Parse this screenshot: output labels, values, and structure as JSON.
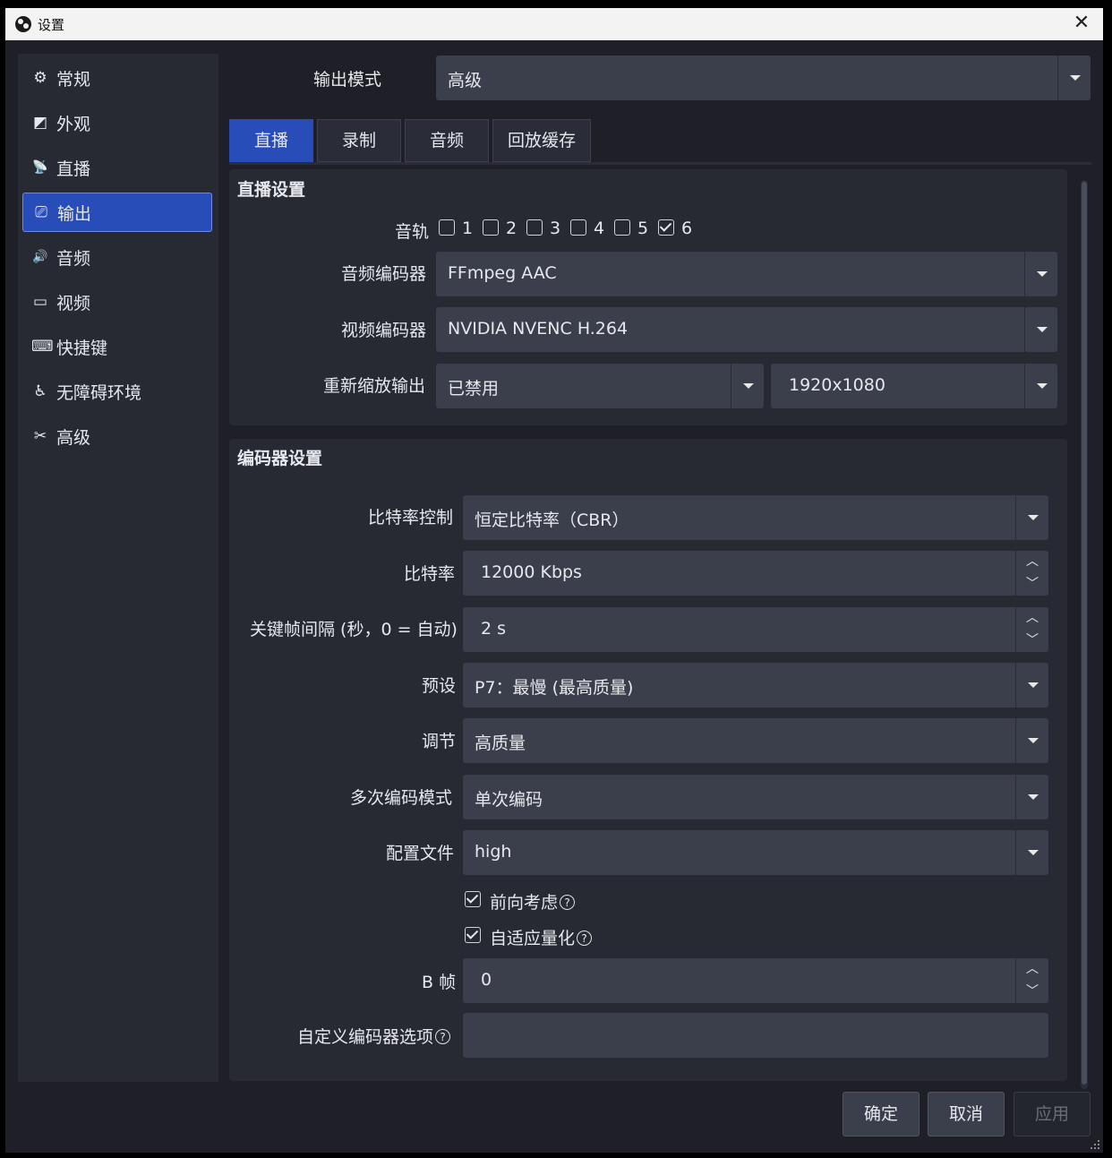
{
  "window": {
    "title": "设置"
  },
  "sidebar": {
    "items": [
      {
        "label": "常规",
        "icon": "gear-icon",
        "glyph": "⚙"
      },
      {
        "label": "外观",
        "icon": "appearance-icon",
        "glyph": "◩"
      },
      {
        "label": "直播",
        "icon": "broadcast-icon",
        "glyph": "📡"
      },
      {
        "label": "输出",
        "icon": "output-icon",
        "glyph": "⎚"
      },
      {
        "label": "音频",
        "icon": "speaker-icon",
        "glyph": "🔊"
      },
      {
        "label": "视频",
        "icon": "monitor-icon",
        "glyph": "▭"
      },
      {
        "label": "快捷键",
        "icon": "keyboard-icon",
        "glyph": "⌨"
      },
      {
        "label": "无障碍环境",
        "icon": "accessibility-icon",
        "glyph": "♿"
      },
      {
        "label": "高级",
        "icon": "tools-icon",
        "glyph": "✂"
      }
    ],
    "active_index": 3
  },
  "output_mode": {
    "label": "输出模式",
    "value": "高级"
  },
  "tabs": [
    {
      "label": "直播",
      "active": true
    },
    {
      "label": "录制",
      "active": false
    },
    {
      "label": "音频",
      "active": false
    },
    {
      "label": "回放缓存",
      "active": false
    }
  ],
  "stream_settings": {
    "title": "直播设置",
    "tracks_label": "音轨",
    "tracks": [
      {
        "label": "1",
        "checked": false
      },
      {
        "label": "2",
        "checked": false
      },
      {
        "label": "3",
        "checked": false
      },
      {
        "label": "4",
        "checked": false
      },
      {
        "label": "5",
        "checked": false
      },
      {
        "label": "6",
        "checked": true
      }
    ],
    "audio_encoder": {
      "label": "音频编码器",
      "value": "FFmpeg AAC"
    },
    "video_encoder": {
      "label": "视频编码器",
      "value": "NVIDIA NVENC H.264"
    },
    "rescale": {
      "label": "重新缩放输出",
      "value": "已禁用",
      "resolution": "1920x1080"
    }
  },
  "encoder_settings": {
    "title": "编码器设置",
    "rate_control": {
      "label": "比特率控制",
      "value": "恒定比特率（CBR）"
    },
    "bitrate": {
      "label": "比特率",
      "value": "12000 Kbps"
    },
    "keyframe": {
      "label": "关键帧间隔 (秒，0 = 自动)",
      "value": "2 s"
    },
    "preset": {
      "label": "预设",
      "value": "P7：最慢 (最高质量)"
    },
    "tuning": {
      "label": "调节",
      "value": "高质量"
    },
    "multipass": {
      "label": "多次编码模式",
      "value": "单次编码"
    },
    "profile": {
      "label": "配置文件",
      "value": "high"
    },
    "lookahead": {
      "label": "前向考虑",
      "checked": true
    },
    "adaptive_quant": {
      "label": "自适应量化",
      "checked": true
    },
    "bframes": {
      "label": "B 帧",
      "value": "0"
    },
    "custom_options": {
      "label": "自定义编码器选项",
      "value": ""
    }
  },
  "buttons": {
    "ok": "确定",
    "cancel": "取消",
    "apply": "应用"
  },
  "glyphs": {
    "help": "?",
    "up": "︿",
    "down": "﹀",
    "close": "✕"
  }
}
